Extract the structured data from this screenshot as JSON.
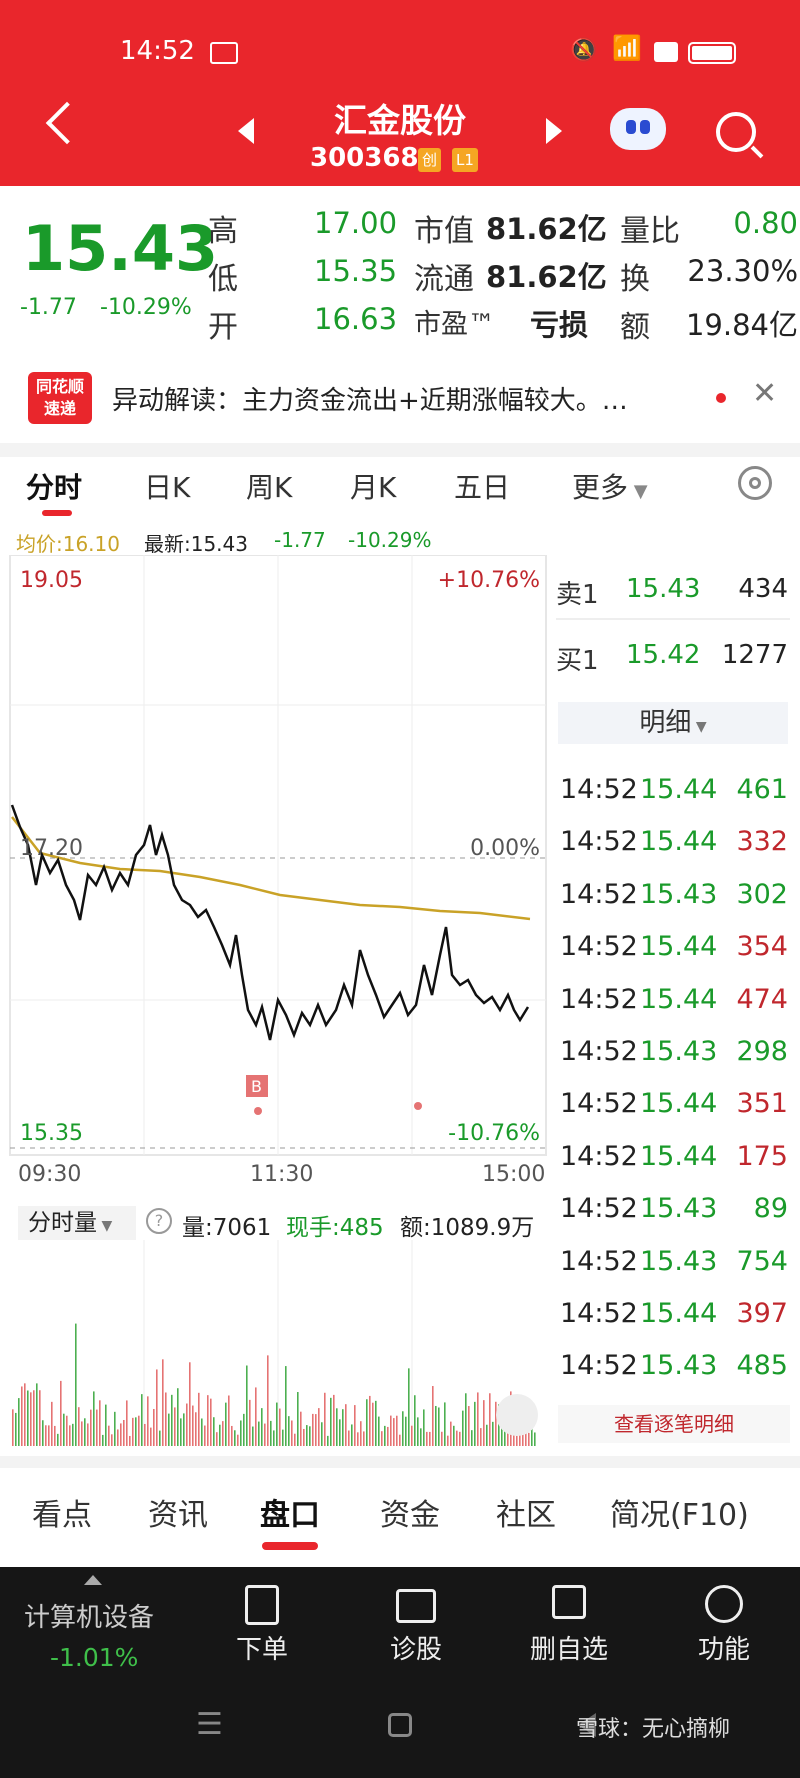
{
  "status_bar": {
    "time": "14:52"
  },
  "header": {
    "stock_name": "汇金股份",
    "stock_code": "300368",
    "badge_chuang": "创",
    "badge_level": "L1"
  },
  "quote": {
    "price": "15.43",
    "change": "-1.77",
    "change_pct": "-10.29%",
    "high_label": "高",
    "high": "17.00",
    "low_label": "低",
    "low": "15.35",
    "open_label": "开",
    "open": "16.63",
    "mcap_label": "市值",
    "mcap": "81.62亿",
    "float_label": "流通",
    "float": "81.62亿",
    "pe_label": "市盈™",
    "pe": "亏损",
    "vr_label": "量比",
    "vr": "0.80",
    "turnover_label": "换",
    "turnover": "23.30%",
    "amount_label": "额",
    "amount": "19.84亿"
  },
  "news": {
    "logo_line1": "同花顺",
    "logo_line2": "速递",
    "text": "异动解读：主力资金流出+近期涨幅较大。…"
  },
  "tabs": [
    "分时",
    "日K",
    "周K",
    "月K",
    "五日",
    "更多"
  ],
  "chart_info": {
    "avg": "均价:16.10",
    "latest": "最新:15.43",
    "change": "-1.77",
    "change_pct": "-10.29%"
  },
  "chart": {
    "y_top": "19.05",
    "y_top_pct": "+10.76%",
    "y_mid": "17.20",
    "y_mid_pct": "0.00%",
    "y_bot": "15.35",
    "y_bot_pct": "-10.76%",
    "x_start": "09:30",
    "x_mid": "11:30",
    "x_end": "15:00",
    "b_marker": "B"
  },
  "volume_info": {
    "label": "分时量",
    "vol": "量:7061",
    "hand": "现手:485",
    "amt": "额:1089.9万"
  },
  "order_book": {
    "sell_label": "卖1",
    "sell_price": "15.43",
    "sell_vol": "434",
    "buy_label": "买1",
    "buy_price": "15.42",
    "buy_vol": "1277",
    "detail_label": "明细"
  },
  "ticks": [
    {
      "t": "14:52",
      "p": "15.44",
      "v": "461",
      "c": "#1a9a2a"
    },
    {
      "t": "14:52",
      "p": "15.44",
      "v": "332",
      "c": "#c0272d"
    },
    {
      "t": "14:52",
      "p": "15.43",
      "v": "302",
      "c": "#1a9a2a"
    },
    {
      "t": "14:52",
      "p": "15.44",
      "v": "354",
      "c": "#c0272d"
    },
    {
      "t": "14:52",
      "p": "15.44",
      "v": "474",
      "c": "#c0272d"
    },
    {
      "t": "14:52",
      "p": "15.43",
      "v": "298",
      "c": "#1a9a2a"
    },
    {
      "t": "14:52",
      "p": "15.44",
      "v": "351",
      "c": "#c0272d"
    },
    {
      "t": "14:52",
      "p": "15.44",
      "v": "175",
      "c": "#c0272d"
    },
    {
      "t": "14:52",
      "p": "15.43",
      "v": "89",
      "c": "#1a9a2a"
    },
    {
      "t": "14:52",
      "p": "15.43",
      "v": "754",
      "c": "#1a9a2a"
    },
    {
      "t": "14:52",
      "p": "15.44",
      "v": "397",
      "c": "#c0272d"
    },
    {
      "t": "14:52",
      "p": "15.43",
      "v": "485",
      "c": "#1a9a2a"
    }
  ],
  "view_all": "查看逐笔明细",
  "bottom_tabs": [
    "看点",
    "资讯",
    "盘口",
    "资金",
    "社区",
    "简况(F10)"
  ],
  "bottom_bar": {
    "sector": "计算机设备",
    "sector_pct": "-1.01%",
    "order": "下单",
    "diagnose": "诊股",
    "remove_fav": "删自选",
    "func": "功能"
  },
  "watermark": "雪球：无心摘柳",
  "colors": {
    "red": "#e9262c",
    "green": "#1a9a2a",
    "avg_line": "#c9a227"
  }
}
